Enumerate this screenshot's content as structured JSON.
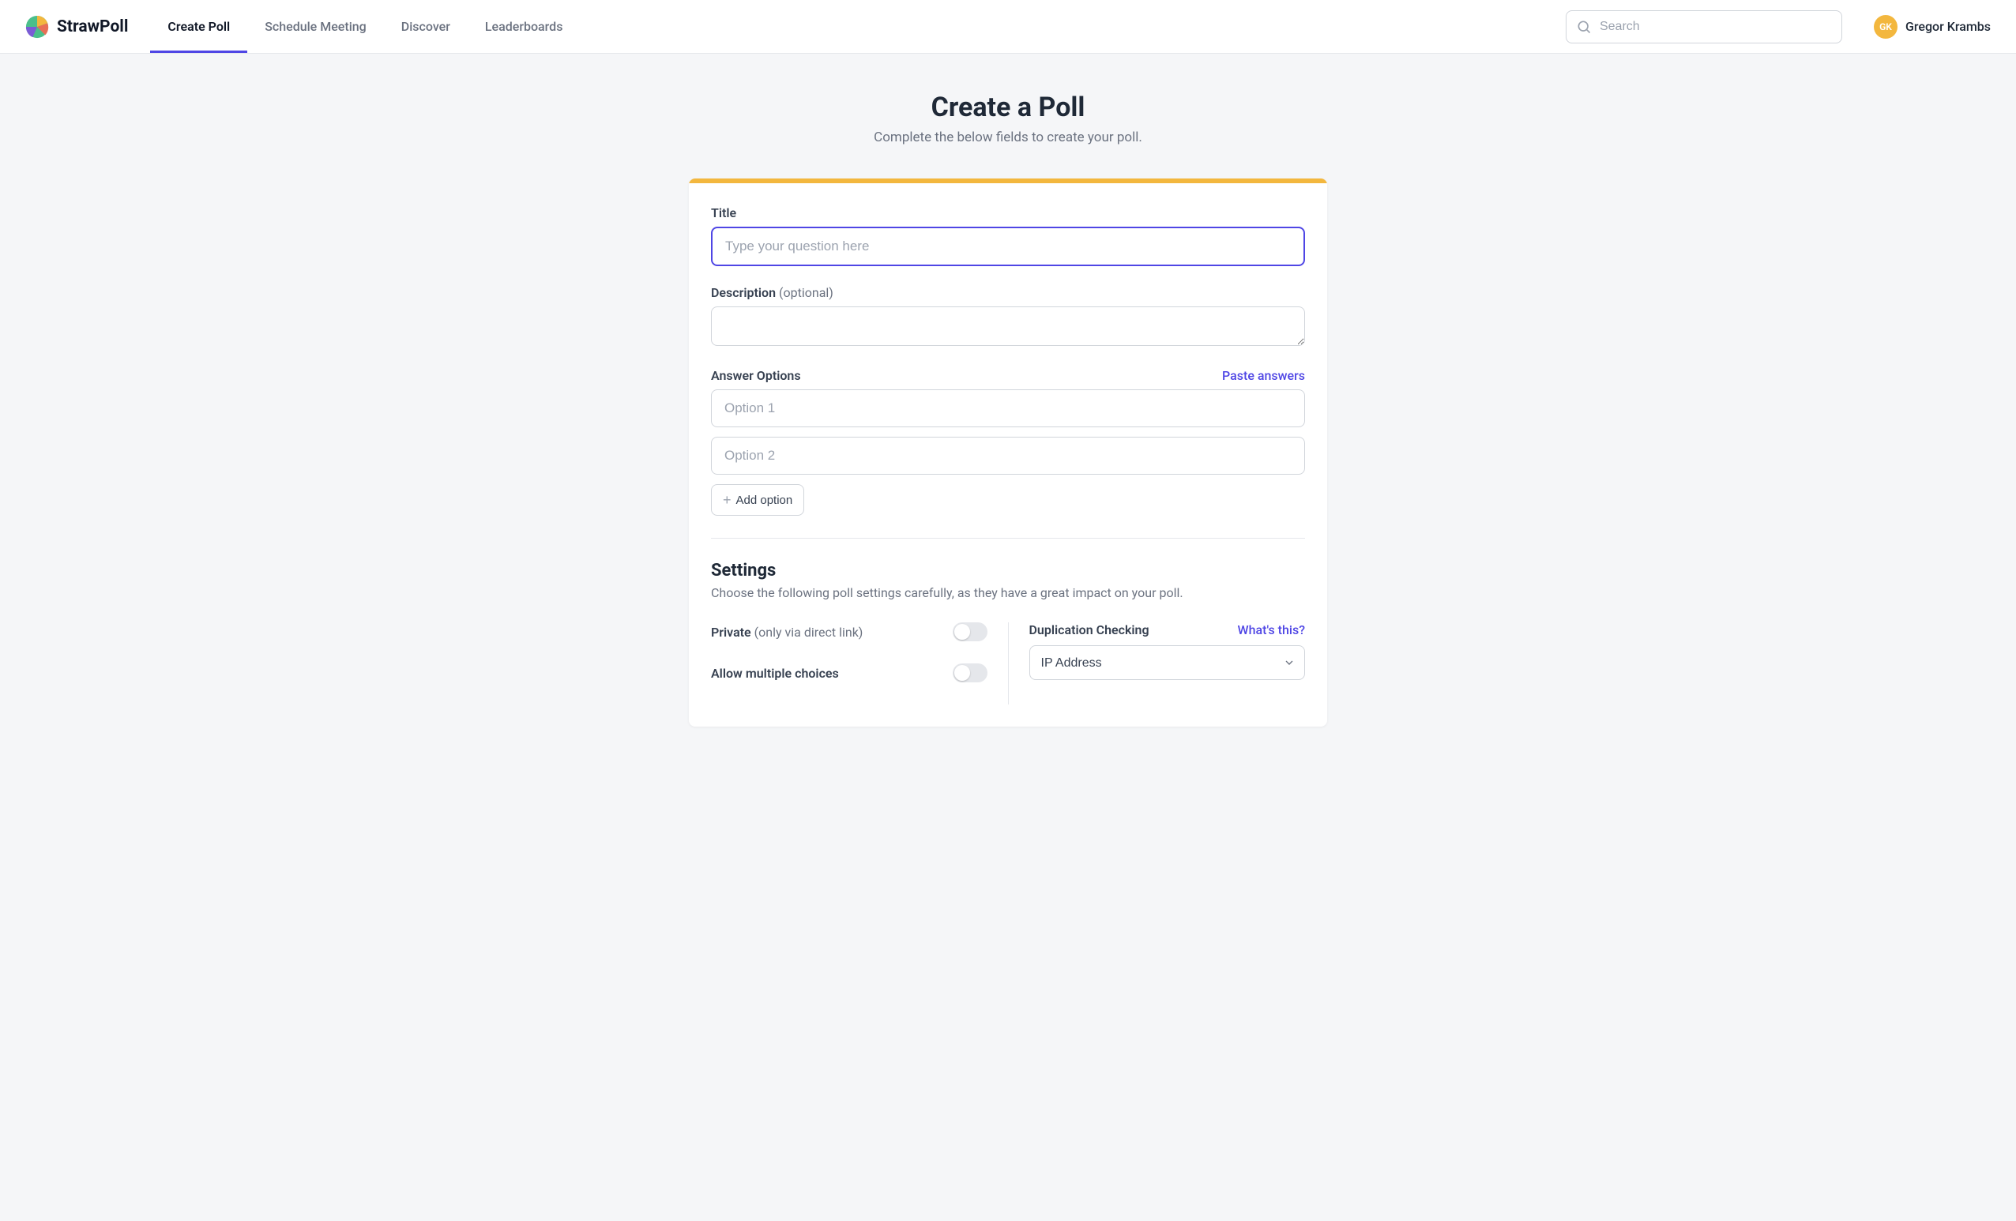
{
  "brand": "StrawPoll",
  "nav": {
    "create_poll": "Create Poll",
    "schedule_meeting": "Schedule Meeting",
    "discover": "Discover",
    "leaderboards": "Leaderboards"
  },
  "search": {
    "placeholder": "Search"
  },
  "user": {
    "initials": "GK",
    "name": "Gregor Krambs"
  },
  "page": {
    "title": "Create a Poll",
    "subtitle": "Complete the below fields to create your poll."
  },
  "form": {
    "title_label": "Title",
    "title_placeholder": "Type your question here",
    "desc_label": "Description",
    "desc_optional": "(optional)",
    "answers_label": "Answer Options",
    "paste_link": "Paste answers",
    "option1_placeholder": "Option 1",
    "option2_placeholder": "Option 2",
    "add_option": "Add option"
  },
  "settings": {
    "heading": "Settings",
    "sub": "Choose the following poll settings carefully, as they have a great impact on your poll.",
    "private_label": "Private",
    "private_hint": "(only via direct link)",
    "multi_label": "Allow multiple choices",
    "dup_label": "Duplication Checking",
    "whats_this": "What's this?",
    "dup_value": "IP Address"
  }
}
